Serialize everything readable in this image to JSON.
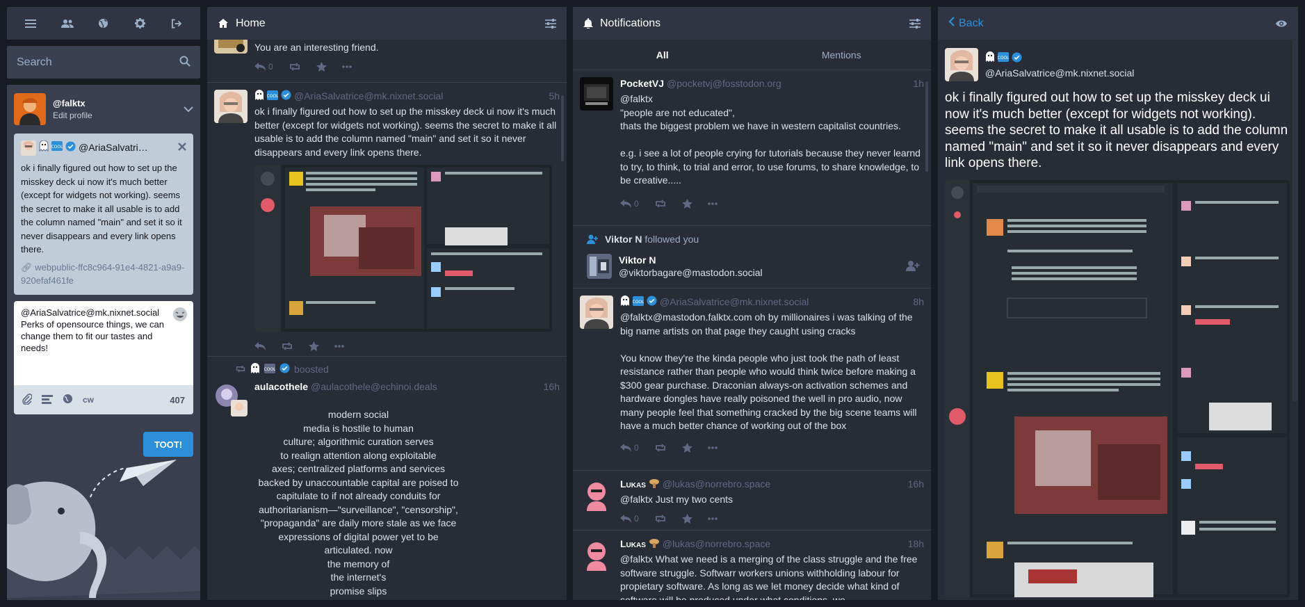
{
  "nav": {
    "items": [
      "menu-icon",
      "people-icon",
      "globe-icon",
      "gear-icon",
      "logout-icon"
    ]
  },
  "search": {
    "placeholder": "Search"
  },
  "profile": {
    "handle": "@falktx",
    "edit_label": "Edit profile"
  },
  "reply": {
    "name": "@AriaSalvatric...",
    "text": "ok i finally figured out how to set up the misskey deck ui now it's much better (except for widgets not working). seems the secret to make it all usable is to add the column named \"main\" and set it so it never disappears and every link opens there.",
    "link": "webpublic-ffc8c964-91e4-4821-a9a9-920efaf461fe"
  },
  "composer": {
    "text": "@AriaSalvatrice@mk.nixnet.social Perks of opensource things, we can change them to fit our tastes and needs!",
    "cw_label": "cw",
    "char_count": "407",
    "submit_label": "TOOT!"
  },
  "home": {
    "title": "Home",
    "top_partial": {
      "text": "You are an interesting friend.",
      "reply_count": "0"
    },
    "status1": {
      "handle": "@AriaSalvatrice@mk.nixnet.social",
      "time": "5h",
      "text": "ok i finally figured out how to set up the misskey deck ui now it's much better (except for widgets not working). seems the secret to make it all usable is to add the column named \"main\" and set it so it never disappears and every link opens there."
    },
    "boost": {
      "label": "boosted"
    },
    "status2": {
      "name": "aulacothele",
      "handle": "@aulacothele@echinoi.deals",
      "time": "16h",
      "text": "modern social\nmedia is hostile to human\nculture; algorithmic curation serves\nto realign attention along exploitable\naxes; centralized platforms and services\nbacked by unaccountable capital are poised to\ncapitulate to if not already conduits for\nauthoritarianism—\"surveillance\", \"censorship\",\n\"propaganda\" are daily more stale as we face\nexpressions of digital power yet to be\narticulated. now\nthe memory of\nthe internet's\npromise slips"
    }
  },
  "notifications": {
    "title": "Notifications",
    "tabs": [
      "All",
      "Mentions"
    ],
    "n1": {
      "name": "PocketVJ",
      "handle": "@pocketvj@fosstodon.org",
      "time": "1h",
      "text_a": "@falktx",
      "text_b": "\"people are not educated\",",
      "text_c": "thats the biggest problem we have in western capitalist countries.",
      "text_d": "e.g. i see a lot of people crying for tutorials because they never learnd to try, to think, to trial and error, to use forums, to share knowledge, to be creative.....",
      "reply_count": "0"
    },
    "follow": {
      "title_name": "Viktor N",
      "title_suffix": "followed you",
      "name": "Viktor N",
      "handle": "@viktorbagare@mastodon.social"
    },
    "n2": {
      "handle": "@AriaSalvatrice@mk.nixnet.social",
      "time": "8h",
      "text_a": "@falktx@mastodon.falktx.com oh by millionaires i was talking of the big name artists on that page they caught using cracks",
      "text_b": "You know they're the kinda people who just took the path of least resistance rather than people who would think twice before making a $300 gear purchase. Draconian always-on activation schemes and hardware dongles have really poisoned the well in pro audio, now many people feel that something cracked by the big scene teams will have a much better chance of working out of the box",
      "reply_count": "0"
    },
    "n3": {
      "name": "Lukas",
      "handle": "@lukas@norrebro.space",
      "time": "16h",
      "text": "@falktx Just my two cents",
      "reply_count": "0"
    },
    "n4": {
      "name": "Lukas",
      "handle": "@lukas@norrebro.space",
      "time": "18h",
      "text": "@falktx What we need is a merging of the class struggle and the free software struggle. Softwarr workers unions withholding labour for propietary software. As long as we let money decide what kind of software will be produced under what conditions, we"
    }
  },
  "detail": {
    "back_label": "Back",
    "handle": "@AriaSalvatrice@mk.nixnet.social",
    "text": "ok i finally figured out how to set up the misskey deck ui now it's much better (except for widgets not working). seems the secret to make it all usable is to add the column named \"main\" and set it so it never disappears and every link opens there."
  },
  "colors": {
    "background": "#191b22",
    "column": "#282c37",
    "header": "#313543",
    "accent": "#2b90d9",
    "muted": "#606984"
  }
}
